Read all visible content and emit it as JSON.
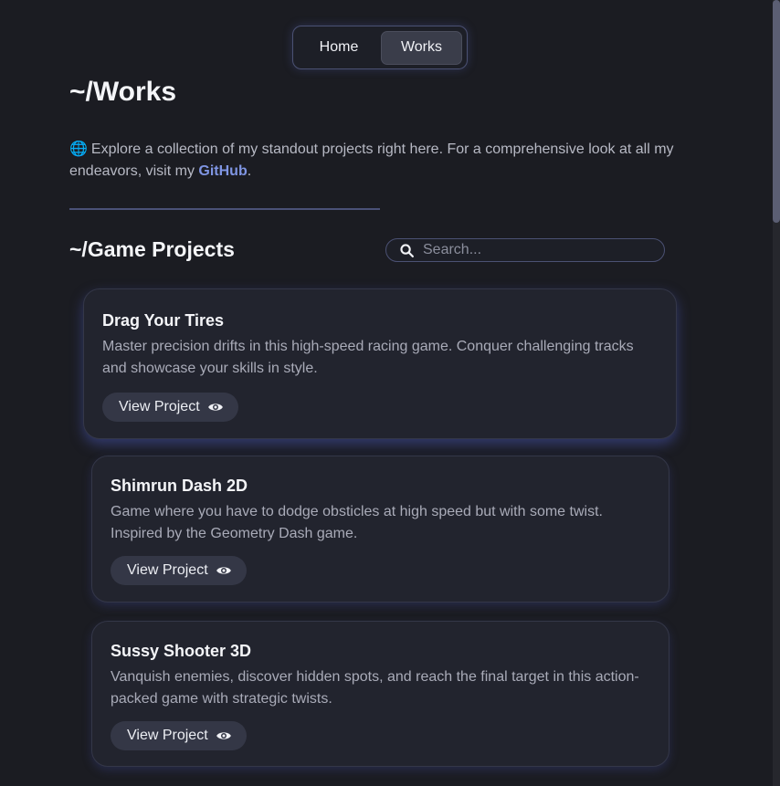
{
  "nav": {
    "home_label": "Home",
    "works_label": "Works"
  },
  "page": {
    "title": "~/Works",
    "intro_icon": "🌐",
    "intro_text": "Explore a collection of my standout projects right here. For a comprehensive look at all my endeavors, visit my ",
    "intro_link": "GitHub",
    "intro_end": "."
  },
  "section": {
    "title": "~/Game Projects"
  },
  "search": {
    "placeholder": "Search..."
  },
  "projects": [
    {
      "title": "Drag Your Tires",
      "description": "Master precision drifts in this high-speed racing game. Conquer challenging tracks and showcase your skills in style.",
      "button": "View Project"
    },
    {
      "title": "Shimrun Dash 2D",
      "description": "Game where you have to dodge obsticles at high speed but with some twist. Inspired by the Geometry Dash game.",
      "button": "View Project"
    },
    {
      "title": "Sussy Shooter 3D",
      "description": "Vanquish enemies, discover hidden spots, and reach the final target in this action-packed game with strategic twists.",
      "button": "View Project"
    }
  ],
  "colors": {
    "background": "#1b1c22",
    "accent": "#7f95e3",
    "card": "#22242e",
    "border": "#4b5173"
  },
  "icons": {
    "search": "search-icon",
    "view": "eye-icon",
    "globe": "globe-icon"
  }
}
